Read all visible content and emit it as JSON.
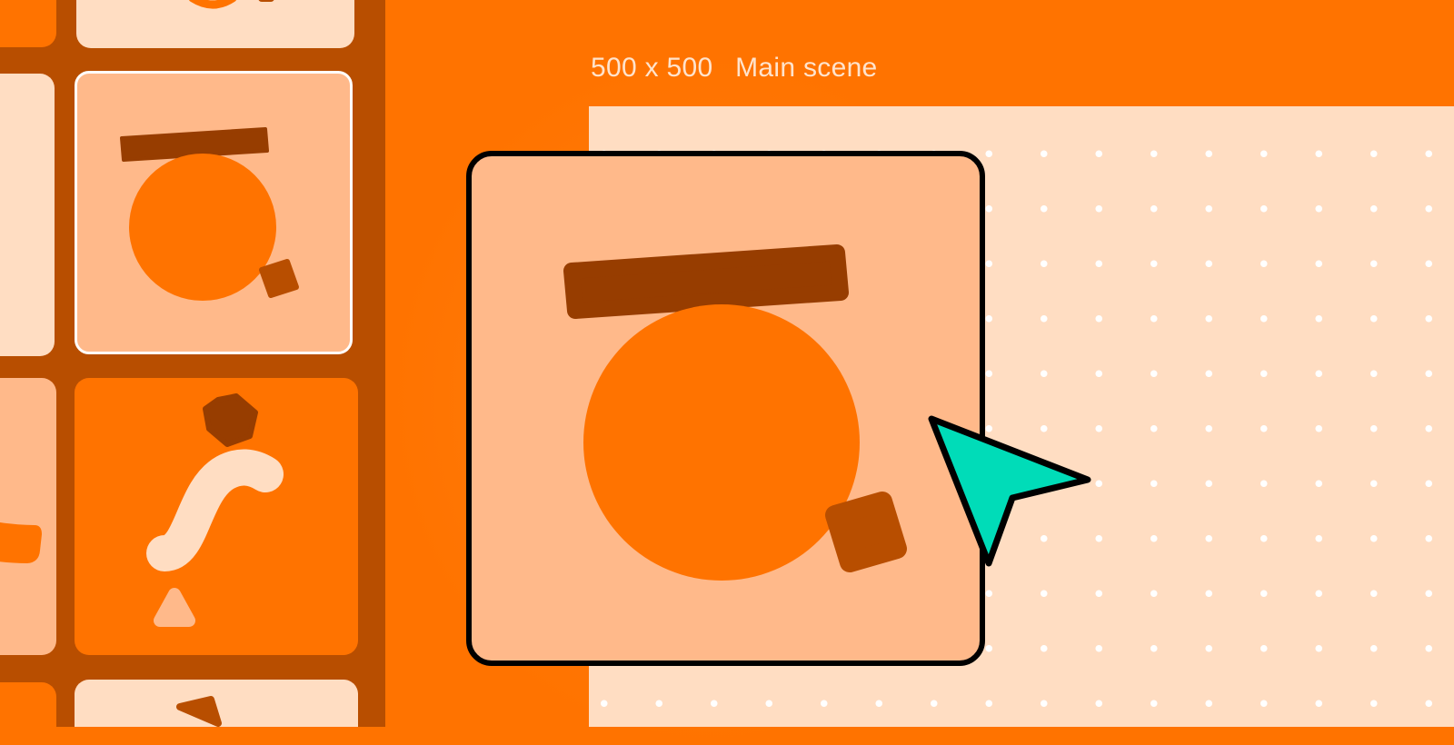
{
  "canvas": {
    "size_label": "500 x 500",
    "scene_name": "Main scene"
  },
  "colors": {
    "background": "#FF7300",
    "sidebar": "#B84E00",
    "canvas": "#FFDDC2",
    "card": "#FFB98A",
    "circle": "#FF7300",
    "bar": "#973D00",
    "cursor": "#00DCB8",
    "selection": "#FFFFFF"
  },
  "thumbnails": [
    {
      "name": "scene-thumbnail",
      "selected": true
    },
    {
      "name": "scene-thumbnail",
      "selected": false
    }
  ],
  "cursor": {
    "icon": "pointer-arrow-icon"
  }
}
